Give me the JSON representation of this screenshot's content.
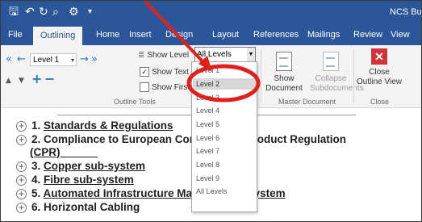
{
  "window": {
    "title": "NCS Bu"
  },
  "quick_access": {
    "icons": [
      "save-icon",
      "undo-icon",
      "redo-icon",
      "print-preview-icon",
      "customize-icon",
      "dropdown-icon"
    ]
  },
  "tabs": [
    "File",
    "Outlining",
    "Home",
    "Insert",
    "Design",
    "Layout",
    "References",
    "Mailings",
    "Review",
    "View"
  ],
  "active_tab": "Outlining",
  "outline_tools": {
    "level_value": "Level 1",
    "show_level_label": "Show Level",
    "show_text_formatting_label": "Show Text Formatting",
    "show_first_line_label": "Show First Line Only",
    "show_text_formatting_checked": true,
    "show_first_line_checked": false,
    "group_label": "Outline Tools"
  },
  "show_level_select": {
    "value": "All Levels"
  },
  "level_options": [
    "Level 1",
    "Level 2",
    "Level 3",
    "Level 4",
    "Level 5",
    "Level 6",
    "Level 7",
    "Level 8",
    "Level 9",
    "All Levels"
  ],
  "highlighted_option": "Level 2",
  "master_document": {
    "show_document_label": "Show Document",
    "collapse_subdocuments_label": "Collapse Subdocuments",
    "group_label": "Master Document"
  },
  "close_group": {
    "close_outline_label": "Close Outline View",
    "group_label": "Close"
  },
  "document_items": [
    {
      "num": "1.",
      "text": "Standards & Regulations"
    },
    {
      "num": "2.",
      "text": "Compliance to European Construction Product Regulation"
    },
    {
      "num": "",
      "text": "(CPR)"
    },
    {
      "num": "3.",
      "text": "Copper sub-system"
    },
    {
      "num": "4.",
      "text": "Fibre sub-system"
    },
    {
      "num": "5.",
      "text": "Automated Infrastructure Management System"
    },
    {
      "num": "6.",
      "text": "Horizontal Cabling"
    }
  ],
  "annotation_color": "#e0201c"
}
